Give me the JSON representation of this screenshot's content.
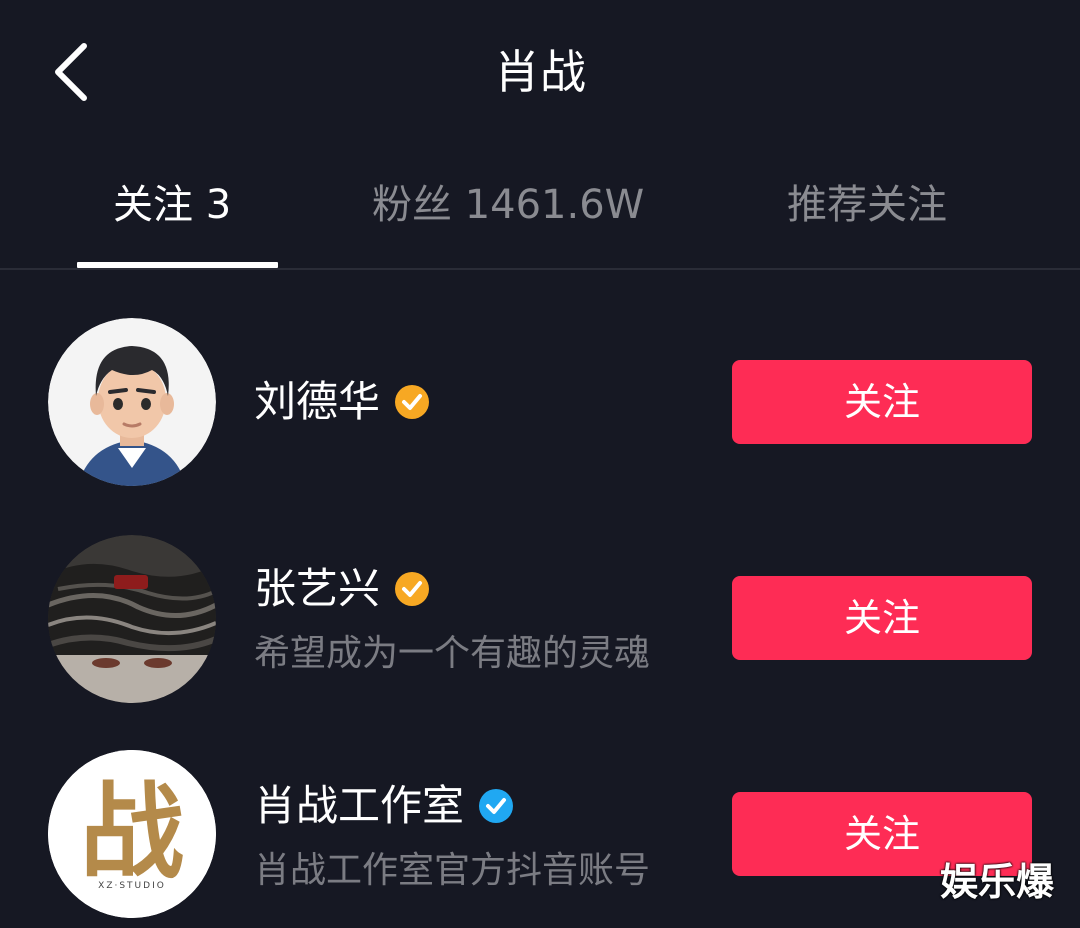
{
  "header": {
    "title": "肖战",
    "back_icon": "chevron-left-icon"
  },
  "tabs": [
    {
      "label": "关注 3",
      "active": true
    },
    {
      "label": "粉丝 1461.6W",
      "active": false
    },
    {
      "label": "推荐关注",
      "active": false
    }
  ],
  "users": [
    {
      "name": "刘德华",
      "description": "",
      "verified_badge": "verified-check-icon",
      "badge_color": "#f7a823",
      "button_label": "关注"
    },
    {
      "name": "张艺兴",
      "description": "希望成为一个有趣的灵魂",
      "verified_badge": "verified-check-icon",
      "badge_color": "#f7a823",
      "button_label": "关注"
    },
    {
      "name": "肖战工作室",
      "description": "肖战工作室官方抖音账号",
      "verified_badge": "verified-check-icon",
      "badge_color": "#20a8f2",
      "button_label": "关注"
    }
  ],
  "avatar3_text": {
    "glyph": "战",
    "caption": "XZ·STUDIO"
  },
  "watermark": "娱乐爆",
  "colors": {
    "background": "#161823",
    "accent": "#fe2c55",
    "inactive_text": "#8a8b91",
    "secondary_text": "#7b7c83"
  }
}
